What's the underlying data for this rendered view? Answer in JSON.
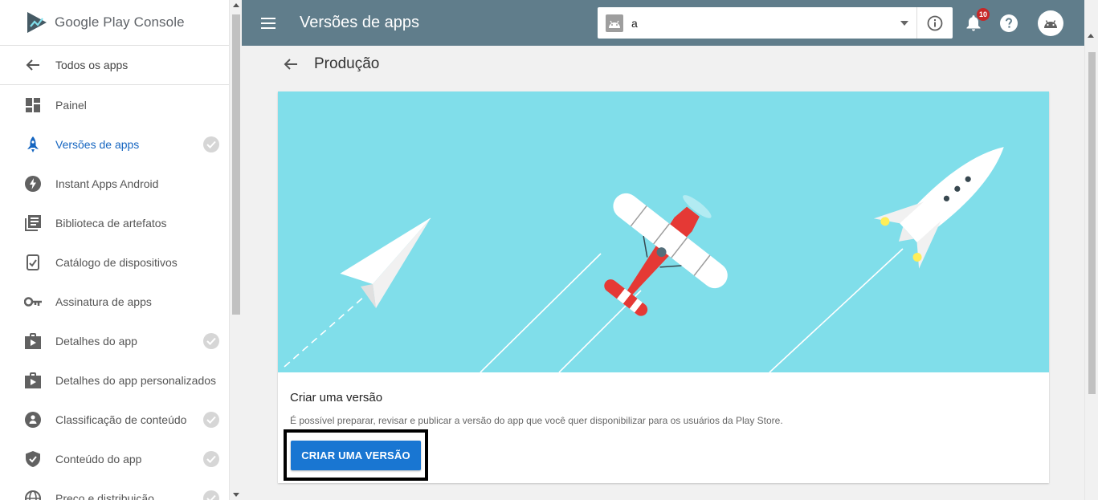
{
  "brand": {
    "google": "Google",
    "play": "Play",
    "console": "Console"
  },
  "sidebar": {
    "back_label": "Todos os apps",
    "items": [
      {
        "label": "Painel",
        "icon": "dashboard-icon",
        "active": false,
        "check": false
      },
      {
        "label": "Versões de apps",
        "icon": "rocket-icon",
        "active": true,
        "check": true
      },
      {
        "label": "Instant Apps Android",
        "icon": "bolt-icon",
        "active": false,
        "check": false
      },
      {
        "label": "Biblioteca de artefatos",
        "icon": "library-icon",
        "active": false,
        "check": false
      },
      {
        "label": "Catálogo de dispositivos",
        "icon": "device-icon",
        "active": false,
        "check": false
      },
      {
        "label": "Assinatura de apps",
        "icon": "key-icon",
        "active": false,
        "check": false
      },
      {
        "label": "Detalhes do app",
        "icon": "play-bag-icon",
        "active": false,
        "check": true
      },
      {
        "label": "Detalhes do app personalizados",
        "icon": "play-bag-icon",
        "active": false,
        "check": false
      },
      {
        "label": "Classificação de conteúdo",
        "icon": "rating-icon",
        "active": false,
        "check": true
      },
      {
        "label": "Conteúdo do app",
        "icon": "shield-icon",
        "active": false,
        "check": true
      },
      {
        "label": "Preço e distribuição",
        "icon": "globe-icon",
        "active": false,
        "check": true
      }
    ]
  },
  "topbar": {
    "title": "Versões de apps",
    "app_selector_value": "a",
    "notifications_count": "10"
  },
  "main": {
    "section_title": "Produção",
    "card": {
      "title": "Criar uma versão",
      "description": "É possível preparar, revisar e publicar a versão do app que você quer disponibilizar para os usuários da Play Store.",
      "button_label": "CRIAR UMA VERSÃO"
    }
  },
  "colors": {
    "topbar": "#607d8b",
    "accent": "#1976d2",
    "active_nav": "#1565c0",
    "hero_bg": "#80deea"
  }
}
